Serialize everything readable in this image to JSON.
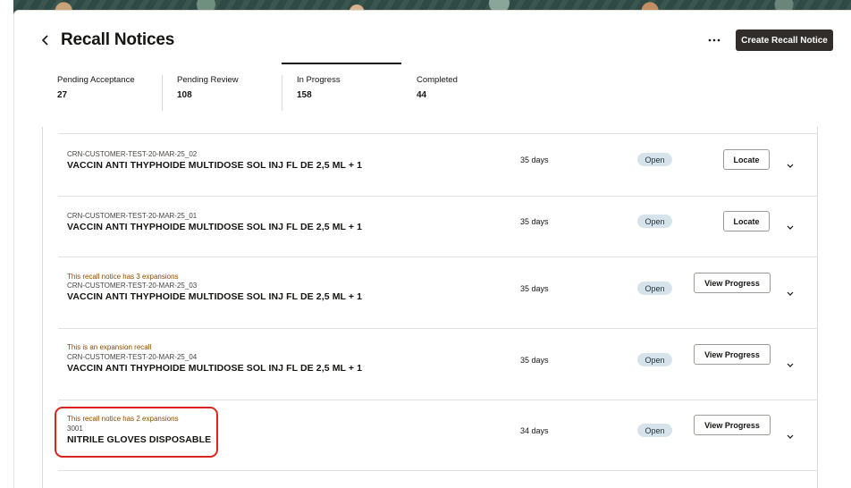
{
  "header": {
    "title": "Recall Notices",
    "create_label": "Create Recall Notice",
    "back_icon": "chevron-left-icon",
    "more_icon": "more-horizontal-icon"
  },
  "tabs": [
    {
      "label": "Pending Acceptance",
      "count": "27"
    },
    {
      "label": "Pending Review",
      "count": "108"
    },
    {
      "label": "In Progress",
      "count": "158"
    },
    {
      "label": "Completed",
      "count": "44"
    }
  ],
  "active_tab": "In Progress",
  "rows": [
    {
      "note": "",
      "id": "CRN-CUSTOMER-TEST-20-MAR-25_02",
      "name": "VACCIN ANTI THYPHOIDE MULTIDOSE SOL INJ FL DE 2,5 ML + 1",
      "age": "35 days",
      "status": "Open",
      "action": "Locate"
    },
    {
      "note": "",
      "id": "CRN-CUSTOMER-TEST-20-MAR-25_01",
      "name": "VACCIN ANTI THYPHOIDE MULTIDOSE SOL INJ FL DE 2,5 ML + 1",
      "age": "35 days",
      "status": "Open",
      "action": "Locate"
    },
    {
      "note": "This recall notice has 3 expansions",
      "id": "CRN-CUSTOMER-TEST-20-MAR-25_03",
      "name": "VACCIN ANTI THYPHOIDE MULTIDOSE SOL INJ FL DE 2,5 ML + 1",
      "age": "35 days",
      "status": "Open",
      "action": "View Progress"
    },
    {
      "note": "This is an expansion recall",
      "id": "CRN-CUSTOMER-TEST-20-MAR-25_04",
      "name": "VACCIN ANTI THYPHOIDE MULTIDOSE SOL INJ FL DE 2,5 ML + 1",
      "age": "35 days",
      "status": "Open",
      "action": "View Progress"
    },
    {
      "note": "This recall notice has 2 expansions",
      "id": "3001",
      "name": "NITRILE GLOVES DISPOSABLE",
      "age": "34 days",
      "status": "Open",
      "action": "View Progress"
    }
  ],
  "colors": {
    "primary_button": "#312d2a",
    "status_badge": "#d7e3ea",
    "note_text": "#8a4b00",
    "highlight": "#d9261c"
  }
}
